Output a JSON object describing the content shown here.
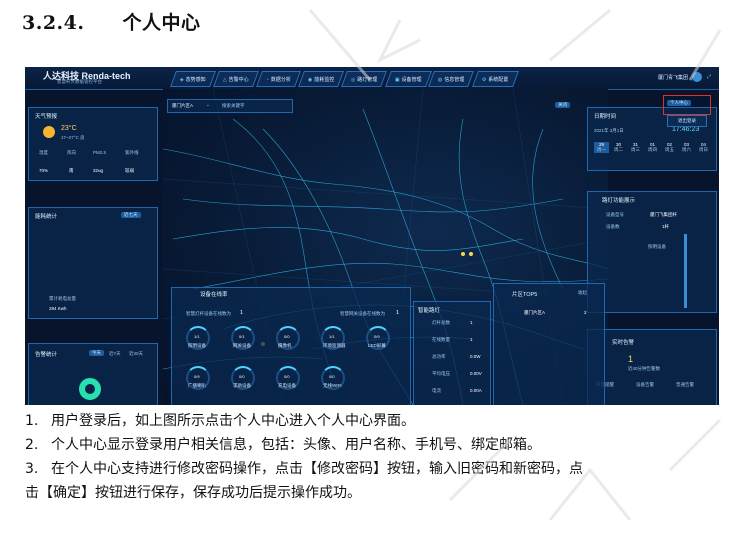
{
  "heading": {
    "number": "3.2.4.",
    "title": "个人中心"
  },
  "screenshot": {
    "app_name": "人达科技 Renda-tech",
    "app_subtitle": "智慧杆大数据管控平台",
    "nav": [
      "态势感知",
      "告警中心",
      "数据分析",
      "能耗监控",
      "路灯管理",
      "设备管理",
      "信息管理",
      "系统配置"
    ],
    "user_name": "厦门青飞集团",
    "user_menu": {
      "profile": "个人中心",
      "logout": "退出登录"
    },
    "region_select": "厦门片区A",
    "search_placeholder": "搜索关键字",
    "weather": {
      "title": "天气预报",
      "temp": "23°C",
      "range": "17~27°C 良",
      "metrics": [
        {
          "label": "湿度",
          "value": "70%"
        },
        {
          "label": "风向",
          "value": "南"
        },
        {
          "label": "PM2.5",
          "value": "32ug"
        },
        {
          "label": "紫外线",
          "value": "较弱"
        }
      ]
    },
    "energy": {
      "title": "能耗统计",
      "range": "近七天",
      "sub": "累计耗电总量",
      "value": "284 Kwh"
    },
    "alarm_stats": {
      "title": "告警统计",
      "tabs": [
        "今天",
        "近7天",
        "近30天"
      ]
    },
    "date": {
      "title": "日期时间",
      "date": "2021年 3月1日",
      "time": "17:46:23",
      "days": [
        "29",
        "30",
        "31",
        "01",
        "02",
        "03",
        "04"
      ],
      "weekdays": [
        "周一",
        "周二",
        "周三",
        "周四",
        "周五",
        "周六",
        "周日"
      ]
    },
    "pole": {
      "title": "路灯功能展示",
      "rows": [
        {
          "label": "设备型号",
          "value": "厦门飞集团杆"
        },
        {
          "label": "设备数",
          "value": "1杆"
        }
      ],
      "link": "照明设备"
    },
    "alarm_live": {
      "title": "实时告警",
      "count": "1",
      "sub": "近40分钟告警数",
      "toggles": [
        "声音提醒",
        "设备告警",
        "普通告警"
      ]
    },
    "device_rate": {
      "title": "设备在线率",
      "left_caption": "智慧灯杆设备在线数为",
      "left_count": "1",
      "right_caption": "智慧网关设备在线数为",
      "right_count": "1",
      "rings": [
        {
          "value": "1/1",
          "label": "照明设备"
        },
        {
          "value": "0/1",
          "label": "网关设备"
        },
        {
          "value": "0/0",
          "label": "摄像机"
        },
        {
          "value": "1/1",
          "label": "环境监测器"
        },
        {
          "value": "0/9",
          "label": "LED屏幕"
        },
        {
          "value": "0/9",
          "label": "广播喇叭"
        },
        {
          "value": "0/0",
          "label": "求助设备"
        },
        {
          "value": "0/0",
          "label": "充电设备"
        },
        {
          "value": "0/0",
          "label": "无线WIFI"
        }
      ]
    },
    "lights": {
      "title": "智能路灯",
      "rows": [
        {
          "label": "灯杆总数",
          "value": "1"
        },
        {
          "label": "在线数量",
          "value": "1"
        },
        {
          "label": "总功率",
          "value": "0.0W"
        },
        {
          "label": "平均电压",
          "value": "0.00V"
        },
        {
          "label": "电流",
          "value": "0.00A"
        }
      ]
    },
    "region_top": {
      "title": "片区TOP5",
      "item": "厦门片区A",
      "count": "2"
    },
    "toggle_label": "关闭",
    "collapse_label": "收起"
  },
  "list": [
    {
      "num": "1.",
      "text": "用户登录后，如上图所示点击个人中心进入个人中心界面。"
    },
    {
      "num": "2.",
      "text": "个人中心显示登录用户相关信息，包括：头像、用户名称、手机号、绑定邮箱。"
    },
    {
      "num": "3.",
      "text": "在个人中心支持进行修改密码操作，点击【修改密码】按钮，输入旧密码和新密码，点",
      "cont": "击【确定】按钮进行保存，保存成功后提示操作成功。"
    }
  ]
}
